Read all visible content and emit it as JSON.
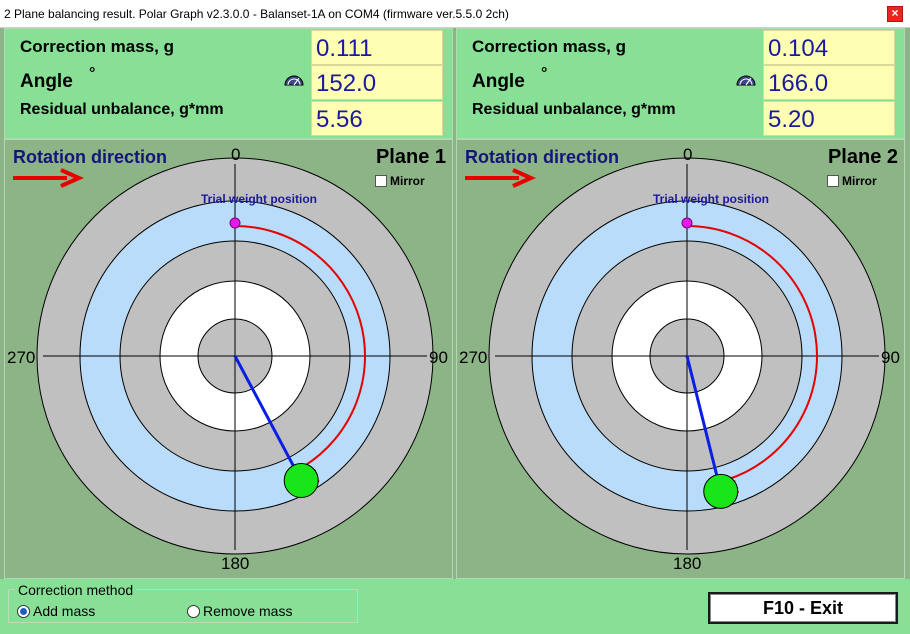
{
  "window": {
    "title": "2 Plane balancing result. Polar Graph v2.3.0.0 - Balanset-1A on COM4 (firmware ver.5.5.0 2ch)",
    "close_glyph": "×"
  },
  "labels": {
    "correction_mass": "Correction mass, g",
    "angle": "Angle",
    "degree_sign": "°",
    "residual_unbalance": "Residual unbalance, g*mm",
    "rotation_direction": "Rotation direction",
    "mirror": "Mirror",
    "trial_weight_position": "Trial weight position"
  },
  "ticks": {
    "top": "0",
    "right": "90",
    "bottom": "180",
    "left": "270"
  },
  "planes": [
    {
      "title": "Plane 1",
      "correction_mass": "0.111",
      "angle": "152.0",
      "residual_unbalance": "5.56",
      "angle_deg": 152,
      "magnitude_frac": 0.91
    },
    {
      "title": "Plane 2",
      "correction_mass": "0.104",
      "angle": "166.0",
      "residual_unbalance": "5.20",
      "angle_deg": 166,
      "magnitude_frac": 0.9
    }
  ],
  "correction_method": {
    "legend": "Correction method",
    "options": [
      {
        "label": "Add mass",
        "checked": true
      },
      {
        "label": "Remove mass",
        "checked": false
      }
    ]
  },
  "exit_button": {
    "label": "F10 - Exit"
  },
  "colors": {
    "ring_outer": "#c0c0c0",
    "ring_blue": "#b9dcfa",
    "ring_white": "#ffffff",
    "vector": "#0a1ee6",
    "arc": "#e60000",
    "mass_marker": "#19e619",
    "trial_marker": "#e619e6"
  }
}
